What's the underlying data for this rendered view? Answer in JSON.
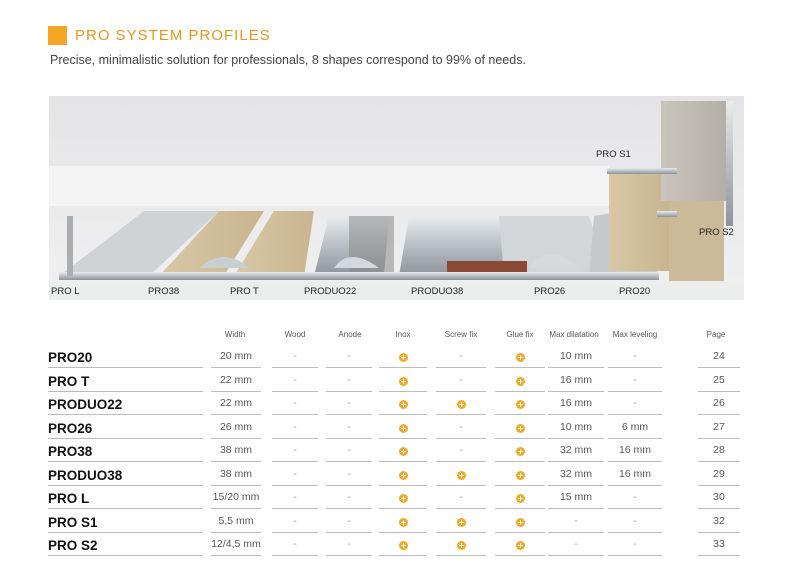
{
  "header": {
    "title": "PRO SYSTEM PROFILES",
    "subtitle": "Precise, minimalistic solution for professionals, 8 shapes correspond to 99% of needs.",
    "accent_color": "#f5a623"
  },
  "illustration": {
    "labels": {
      "pro_l": "PRO L",
      "pro38": "PRO38",
      "pro_t": "PRO T",
      "produo22": "PRODUO22",
      "produo38": "PRODUO38",
      "pro26": "PRO26",
      "pro20": "PRO20",
      "pro_s1": "PRO S1",
      "pro_s2": "PRO S2"
    }
  },
  "table": {
    "columns": {
      "width": "Width",
      "wood": "Wood",
      "anode": "Anode",
      "inox": "Inox",
      "screw": "Screw fix",
      "glue": "Glue fix",
      "dilatation": "Max dilatation",
      "leveling": "Max leveling",
      "page": "Page"
    },
    "rows": [
      {
        "name": "PRO20",
        "width": "20 mm",
        "wood": "-",
        "anode": "-",
        "inox": true,
        "screw": "-",
        "glue": true,
        "dilatation": "10 mm",
        "leveling": "-",
        "page": "24"
      },
      {
        "name": "PRO T",
        "width": "22 mm",
        "wood": "-",
        "anode": "-",
        "inox": true,
        "screw": "-",
        "glue": true,
        "dilatation": "16 mm",
        "leveling": "-",
        "page": "25"
      },
      {
        "name": "PRODUO22",
        "width": "22 mm",
        "wood": "-",
        "anode": "-",
        "inox": true,
        "screw": true,
        "glue": true,
        "dilatation": "16 mm",
        "leveling": "-",
        "page": "26"
      },
      {
        "name": "PRO26",
        "width": "26 mm",
        "wood": "-",
        "anode": "-",
        "inox": true,
        "screw": "-",
        "glue": true,
        "dilatation": "10 mm",
        "leveling": "6 mm",
        "page": "27"
      },
      {
        "name": "PRO38",
        "width": "38 mm",
        "wood": "-",
        "anode": "-",
        "inox": true,
        "screw": "-",
        "glue": true,
        "dilatation": "32 mm",
        "leveling": "16 mm",
        "page": "28"
      },
      {
        "name": "PRODUO38",
        "width": "38 mm",
        "wood": "-",
        "anode": "-",
        "inox": true,
        "screw": true,
        "glue": true,
        "dilatation": "32 mm",
        "leveling": "16 mm",
        "page": "29"
      },
      {
        "name": "PRO L",
        "width": "15/20 mm",
        "wood": "-",
        "anode": "-",
        "inox": true,
        "screw": "-",
        "glue": true,
        "dilatation": "15 mm",
        "leveling": "-",
        "page": "30"
      },
      {
        "name": "PRO S1",
        "width": "5,5 mm",
        "wood": "-",
        "anode": "-",
        "inox": true,
        "screw": true,
        "glue": true,
        "dilatation": "-",
        "leveling": "-",
        "page": "32"
      },
      {
        "name": "PRO S2",
        "width": "12/4,5 mm",
        "wood": "-",
        "anode": "-",
        "inox": true,
        "screw": true,
        "glue": true,
        "dilatation": "-",
        "leveling": "-",
        "page": "33"
      }
    ]
  }
}
